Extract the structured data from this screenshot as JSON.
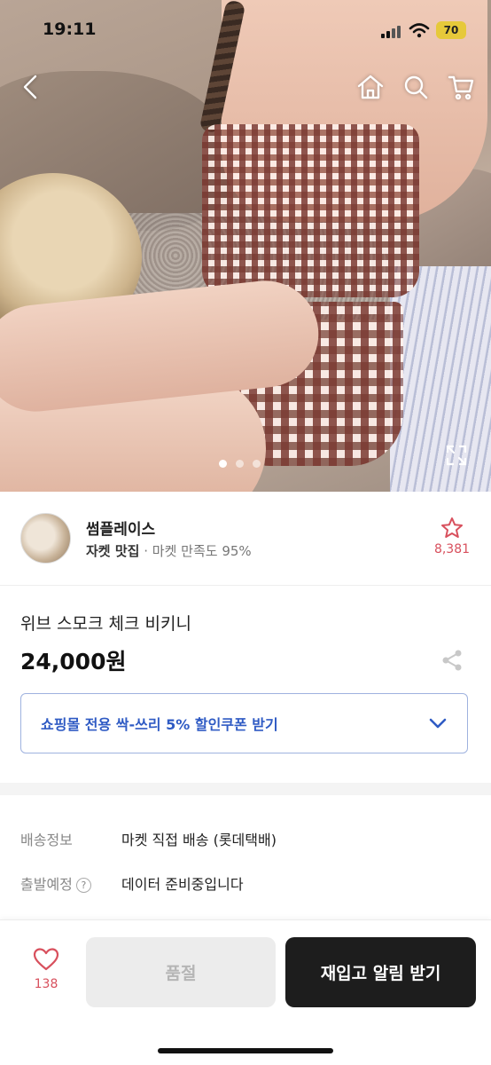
{
  "status_bar": {
    "time": "19:11",
    "battery": "70"
  },
  "hero": {
    "image_index": 1,
    "image_count": 3
  },
  "seller": {
    "name": "썸플레이스",
    "tag": "자켓 맛집",
    "separator": "·",
    "satisfaction": "마켓 만족도 95%",
    "favorite_count": "8,381"
  },
  "product": {
    "name": "위브 스모크 체크 비키니",
    "price": "24,000원"
  },
  "coupon": {
    "label": "쇼핑몰 전용 싹-쓰리 5% 할인쿠폰 받기"
  },
  "shipping": {
    "label": "배송정보",
    "value": "마켓 직접 배송 (롯데택배)"
  },
  "departure": {
    "label": "출발예정",
    "help": "?",
    "value": "데이터 준비중입니다"
  },
  "bottom": {
    "like_count": "138",
    "soldout_label": "품절",
    "restock_label": "재입고 알림 받기"
  },
  "colors": {
    "accent_red": "#d8505d",
    "coupon_blue": "#2f5bc4",
    "dark_button": "#1d1d1d"
  },
  "icons": [
    "back-icon",
    "home-icon",
    "search-icon",
    "cart-icon",
    "expand-icon",
    "star-icon",
    "share-icon",
    "chevron-down-icon",
    "heart-icon"
  ]
}
